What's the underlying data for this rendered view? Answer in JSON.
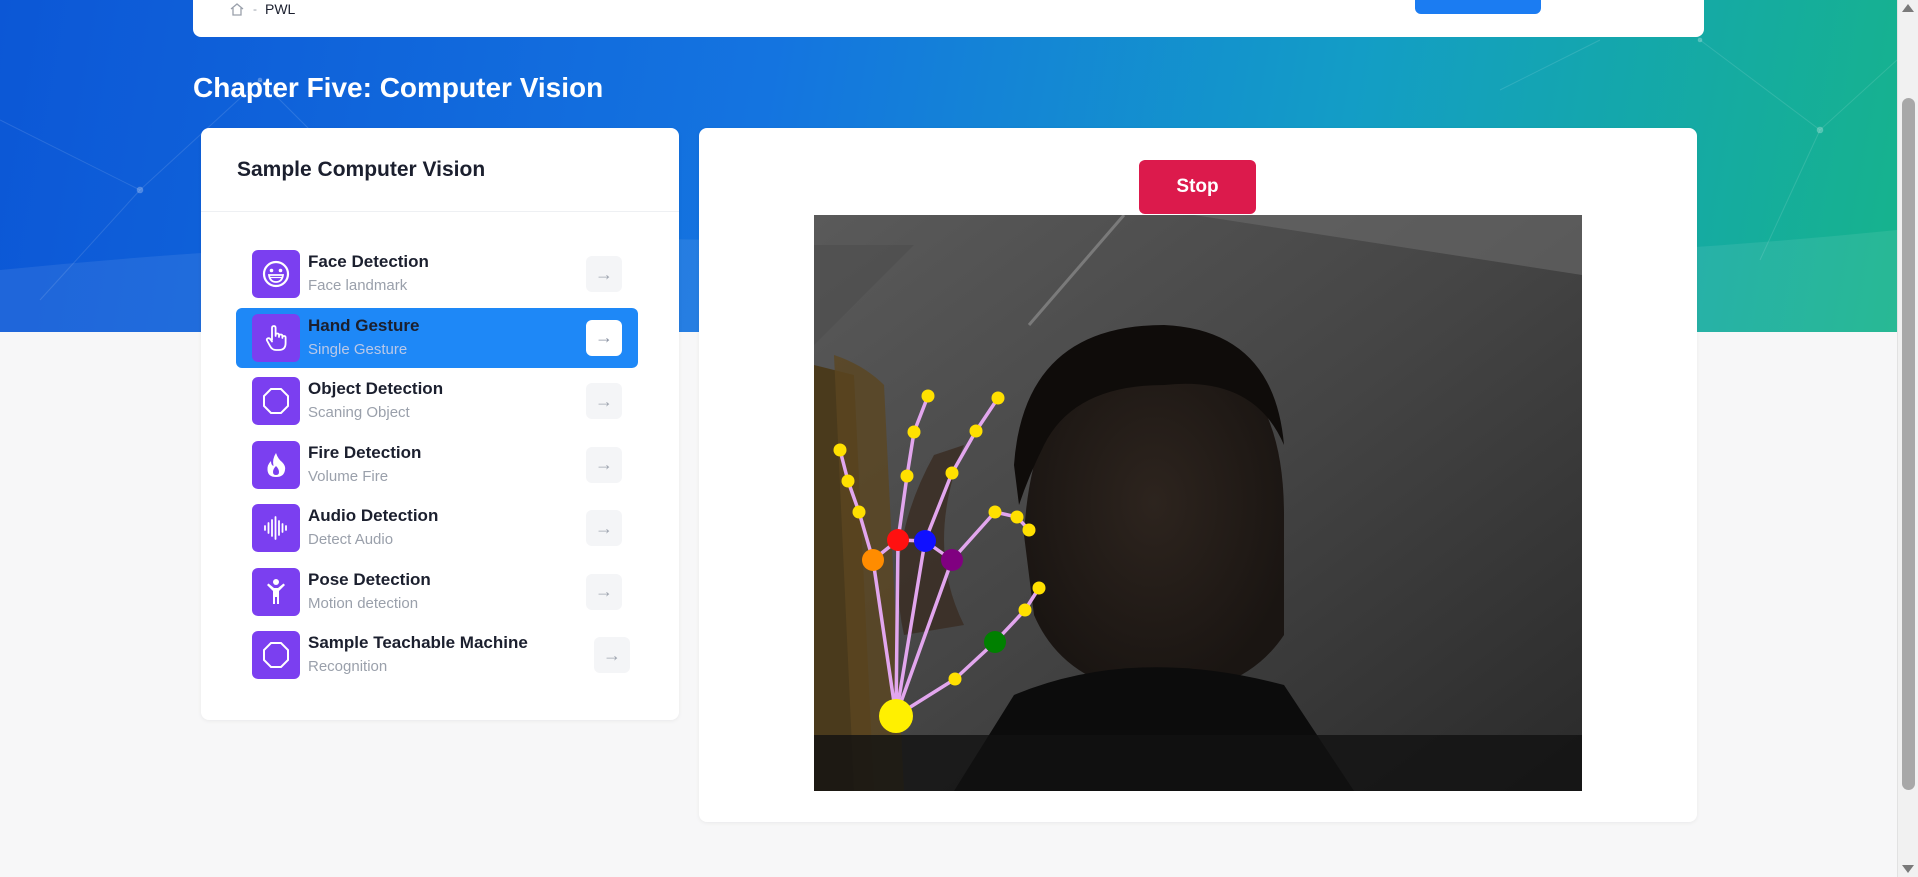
{
  "breadcrumb": {
    "home_icon": "home-icon",
    "separator": "-",
    "current": "PWL"
  },
  "page": {
    "title": "Chapter Five: Computer Vision"
  },
  "sidebar": {
    "heading": "Sample Computer Vision",
    "items": [
      {
        "title": "Face Detection",
        "subtitle": "Face landmark",
        "icon": "smile-face-icon",
        "arrow": "→",
        "active": false
      },
      {
        "title": "Hand Gesture",
        "subtitle": "Single Gesture",
        "icon": "pointing-hand-icon",
        "arrow": "→",
        "active": true
      },
      {
        "title": "Object Detection",
        "subtitle": "Scaning Object",
        "icon": "octagon-icon",
        "arrow": "→",
        "active": false
      },
      {
        "title": "Fire Detection",
        "subtitle": "Volume Fire",
        "icon": "flame-icon",
        "arrow": "→",
        "active": false
      },
      {
        "title": "Audio Detection",
        "subtitle": "Detect Audio",
        "icon": "soundwave-icon",
        "arrow": "→",
        "active": false
      },
      {
        "title": "Pose Detection",
        "subtitle": "Motion detection",
        "icon": "person-pose-icon",
        "arrow": "→",
        "active": false
      },
      {
        "title": "Sample Teachable Machine",
        "subtitle": "Recognition",
        "icon": "octagon-icon",
        "arrow": "→",
        "active": false
      }
    ]
  },
  "main": {
    "stop_label": "Stop",
    "landmark_colors": {
      "line": "#e2a6ee",
      "joint": "#ffe000",
      "wrist": "#fff000",
      "index_base": "#ff1010",
      "middle_base": "#1010ff",
      "ring_base": "#800080",
      "pinky_base": "#ff8c00",
      "thumb_mid": "#008000"
    }
  },
  "colors": {
    "accent": "#1e88f7",
    "icon_bg": "#7b3ff0",
    "stop": "#dc1a4c"
  }
}
